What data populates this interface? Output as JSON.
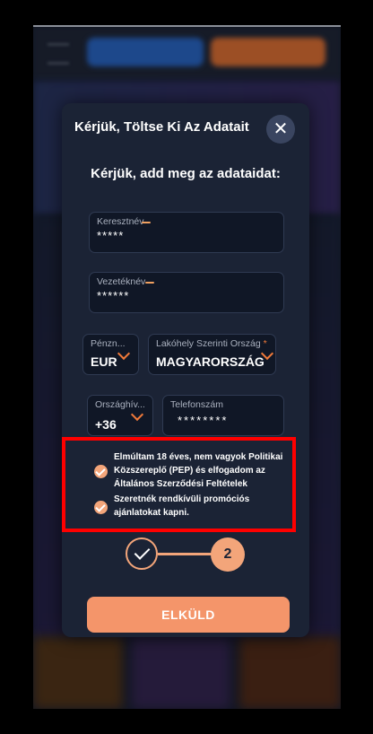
{
  "modal": {
    "title": "Kérjük, Töltse Ki Az Adatait",
    "close_icon": "close-icon",
    "subtitle": "Kérjük, add meg az adataidat:"
  },
  "form": {
    "first_name": {
      "label": "Keresztnév",
      "value": "*****"
    },
    "last_name": {
      "label": "Vezetéknév",
      "value": "******"
    },
    "currency": {
      "label": "Pénzn...",
      "value": "EUR"
    },
    "country": {
      "label": "Lakóhely Szerinti Ország",
      "required_mark": "*",
      "value": "MAGYARORSZÁG"
    },
    "country_code": {
      "label": "Országhív...",
      "value": "+36"
    },
    "phone": {
      "label": "Telefonszám",
      "value": "********"
    }
  },
  "consents": [
    {
      "text": "Elmúltam 18 éves, nem vagyok Politikai Közszereplő (PEP) és elfogadom az Általános Szerződési Feltételek",
      "checked": true
    },
    {
      "text": "Szeretnék rendkívüli promóciós ajánlatokat kapni.",
      "checked": true
    }
  ],
  "steps": {
    "current": "2"
  },
  "submit_label": "ELKÜLD",
  "colors": {
    "accent": "#f4956a",
    "highlight": "#ff0000",
    "modal_bg": "#1b2335"
  }
}
